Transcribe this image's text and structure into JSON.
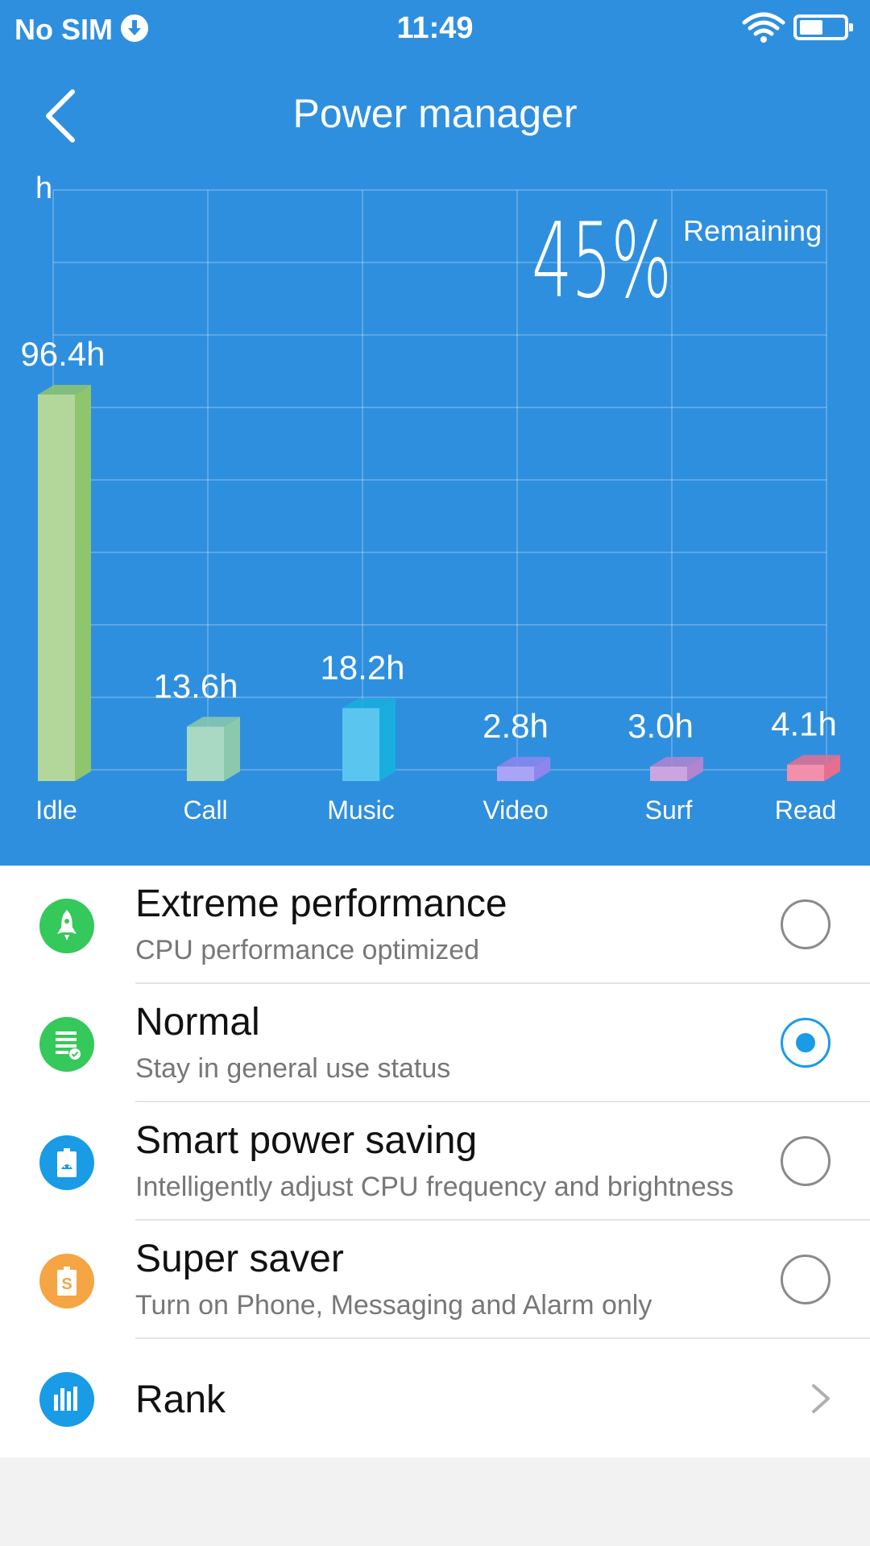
{
  "status_bar": {
    "carrier": "No SIM",
    "time": "11:49",
    "download_icon": "download-icon",
    "wifi_icon": "wifi-icon",
    "battery_icon": "battery-icon"
  },
  "header": {
    "title": "Power manager",
    "back_icon": "chevron-left-icon",
    "background_color": "#2f8fdf"
  },
  "battery": {
    "percent_text": "45%",
    "remaining_label": "Remaining"
  },
  "chart_data": {
    "type": "bar",
    "ylabel": "h",
    "categories": [
      "Idle",
      "Call",
      "Music",
      "Video",
      "Surf",
      "Read"
    ],
    "values": [
      96.4,
      13.6,
      18.2,
      2.8,
      3.0,
      4.1
    ],
    "value_labels": [
      "96.4h",
      "13.6h",
      "18.2h",
      "2.8h",
      "3.0h",
      "4.1h"
    ],
    "colors": [
      "#b3d79a",
      "#a9d9c3",
      "#5ac6ef",
      "#aaa4f7",
      "#c9a6e0",
      "#f28fab"
    ],
    "side_colors": [
      "#8fc56d",
      "#8bc9ae",
      "#1aaede",
      "#8d86ee",
      "#b185d0",
      "#e66e91"
    ],
    "grid": true,
    "ylim": [
      0,
      140
    ]
  },
  "modes": [
    {
      "title": "Extreme performance",
      "subtitle": "CPU performance optimized",
      "icon": "rocket-icon",
      "icon_color": "#35c85a",
      "selected": false
    },
    {
      "title": "Normal",
      "subtitle": "Stay in general use status",
      "icon": "document-check-icon",
      "icon_color": "#35c85a",
      "selected": true
    },
    {
      "title": "Smart power saving",
      "subtitle": "Intelligently adjust CPU frequency and brightness",
      "icon": "android-battery-icon",
      "icon_color": "#1a9be6",
      "selected": false
    },
    {
      "title": "Super saver",
      "subtitle": "Turn on Phone, Messaging and Alarm only",
      "icon": "battery-dollar-icon",
      "icon_color": "#f5a544",
      "selected": false
    }
  ],
  "rank": {
    "title": "Rank",
    "icon": "bar-chart-icon",
    "icon_color": "#1a9be6",
    "chevron_icon": "chevron-right-icon"
  }
}
